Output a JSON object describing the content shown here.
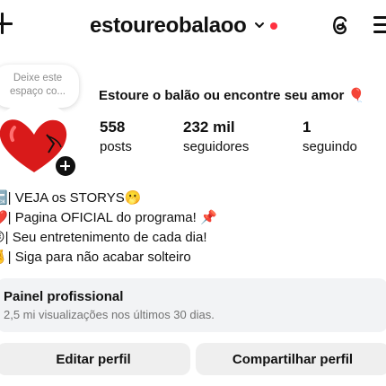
{
  "header": {
    "username": "estoureobalaoo",
    "notification_dot_color": "#ff3040",
    "icons": [
      "plus-icon",
      "chevron-down-icon",
      "threads-icon",
      "menu-icon"
    ]
  },
  "note": {
    "placeholder": "Deixe este espaço co..."
  },
  "profile": {
    "name": "Estoure o balão ou encontre seu amor 🎈",
    "stats": [
      {
        "value": "558",
        "label": "posts"
      },
      {
        "value": "232 mil",
        "label": "seguidores"
      },
      {
        "value": "1",
        "label": "seguindo"
      }
    ]
  },
  "bio": [
    "🔙| VEJA os STORYS🫢",
    "❤️| Pagina OFICIAL do programa! 📌",
    "😜| Seu entretenimento de cada dia!",
    "🤞| Siga para não acabar solteiro"
  ],
  "dashboard": {
    "title": "Painel profissional",
    "subtitle": "2,5 mi visualizações nos últimos 30 dias."
  },
  "actions": {
    "edit_label": "Editar perfil",
    "share_label": "Compartilhar perfil"
  }
}
